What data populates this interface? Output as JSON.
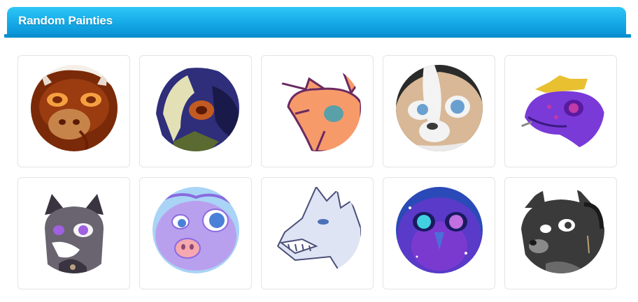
{
  "panel": {
    "title": "Random Painties",
    "header_color": "#16ade9",
    "underline_color": "#0a8fce"
  },
  "painties": [
    {
      "id": "p1",
      "icon": "brown-horned-creature-icon",
      "palette": [
        "#7a2a08",
        "#b5561c",
        "#e8902f",
        "#f5f0e8"
      ]
    },
    {
      "id": "p2",
      "icon": "navy-reptile-icon",
      "palette": [
        "#3b3a9a",
        "#e3e0b6",
        "#c25a22",
        "#ffffff"
      ]
    },
    {
      "id": "p3",
      "icon": "orange-dragon-sketch-icon",
      "palette": [
        "#ffffff",
        "#f79a6a",
        "#6a2a60",
        "#5aa0a8"
      ]
    },
    {
      "id": "p4",
      "icon": "skunk-face-icon",
      "palette": [
        "#2a2a2a",
        "#f3f3f3",
        "#d8b896",
        "#6aa0d0"
      ]
    },
    {
      "id": "p5",
      "icon": "purple-serpent-crown-icon",
      "palette": [
        "#ffffff",
        "#7a3ad8",
        "#e8c030",
        "#c03aa8"
      ]
    },
    {
      "id": "p6",
      "icon": "grey-wolf-icon",
      "palette": [
        "#ffffff",
        "#6a6470",
        "#3a3440",
        "#a060e0"
      ]
    },
    {
      "id": "p7",
      "icon": "lilac-pig-creature-icon",
      "palette": [
        "#a9d4f6",
        "#b9a0ee",
        "#f5a8b0",
        "#4a80d8"
      ]
    },
    {
      "id": "p8",
      "icon": "white-dragon-sketch-icon",
      "palette": [
        "#ffffff",
        "#dfe4f4",
        "#4a4e78",
        "#f2f2ff"
      ]
    },
    {
      "id": "p9",
      "icon": "galaxy-owl-icon",
      "palette": [
        "#2a4ab8",
        "#7a3ad0",
        "#40d0e0",
        "#1a1a60"
      ]
    },
    {
      "id": "p10",
      "icon": "black-dog-headphones-icon",
      "palette": [
        "#ffffff",
        "#3a3a3a",
        "#8a8a8a",
        "#d8d8d8"
      ]
    }
  ]
}
